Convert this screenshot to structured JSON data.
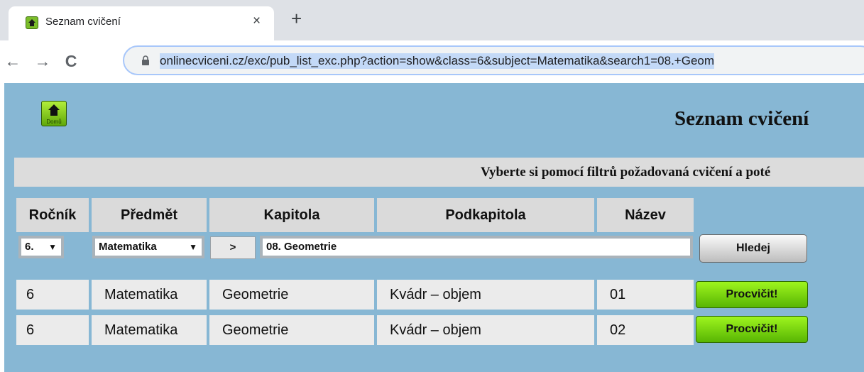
{
  "browser": {
    "tab_title": "Seznam cvičení",
    "tab_close": "×",
    "new_tab": "+",
    "back_icon": "←",
    "forward_icon": "→",
    "reload_icon": "C",
    "url": "onlinecviceni.cz/exc/pub_list_exc.php?action=show&class=6&subject=Matematika&search1=08.+Geom"
  },
  "page": {
    "home_label": "Domů",
    "title": "Seznam cvičení",
    "filter_text": "Vyberte si pomocí filtrů požadovaná cvičení a poté"
  },
  "table": {
    "headers": [
      "Ročník",
      "Předmět",
      "Kapitola",
      "Podkapitola",
      "Název"
    ],
    "filters": {
      "grade": "6.",
      "subject": "Matematika",
      "go_label": ">",
      "chapter": "08. Geometrie",
      "search_label": "Hledej",
      "dropdown_arrow": "▼"
    },
    "rows": [
      {
        "grade": "6",
        "subject": "Matematika",
        "chapter": "Geometrie",
        "subchapter": "Kvádr – objem",
        "name": "01",
        "action": "Procvičit!"
      },
      {
        "grade": "6",
        "subject": "Matematika",
        "chapter": "Geometrie",
        "subchapter": "Kvádr – objem",
        "name": "02",
        "action": "Procvičit!"
      }
    ]
  },
  "colors": {
    "page_background": "#87b7d4",
    "green_button": "#7ed40f",
    "header_gray": "#dadada"
  }
}
